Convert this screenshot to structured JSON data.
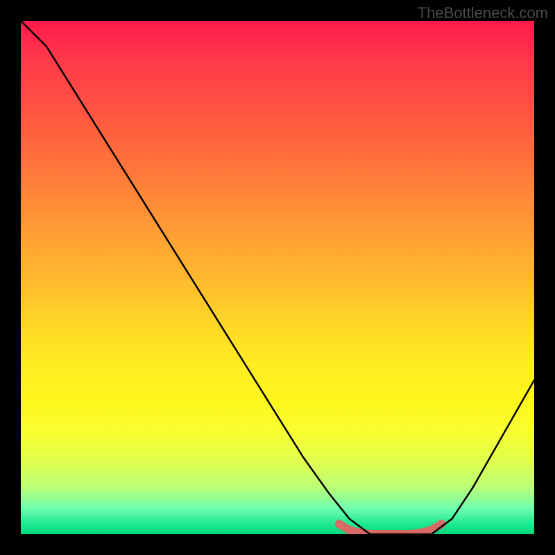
{
  "watermark": "TheBottleneck.com",
  "chart_data": {
    "type": "line",
    "title": "",
    "xlabel": "",
    "ylabel": "",
    "xlim": [
      0,
      100
    ],
    "ylim": [
      0,
      100
    ],
    "series": [
      {
        "name": "bottleneck-curve",
        "x": [
          0,
          5,
          10,
          15,
          20,
          25,
          30,
          35,
          40,
          45,
          50,
          55,
          60,
          64,
          68,
          72,
          76,
          80,
          84,
          88,
          92,
          96,
          100
        ],
        "values": [
          100,
          95,
          87,
          79,
          71,
          63,
          55,
          47,
          39,
          31,
          23,
          15,
          8,
          3,
          0,
          0,
          0,
          0,
          3,
          9,
          16,
          23,
          30
        ],
        "color": "#000000",
        "width": 2.5
      },
      {
        "name": "highlight-segment",
        "x": [
          62,
          64,
          66,
          68,
          70,
          72,
          74,
          76,
          78,
          80,
          82
        ],
        "values": [
          2,
          0.8,
          0.3,
          0,
          0,
          0,
          0,
          0,
          0.3,
          0.8,
          2
        ],
        "color": "#d96b66",
        "width": 12
      }
    ],
    "gradient_stops": [
      {
        "pos": 0,
        "color": "#ff1a4a"
      },
      {
        "pos": 50,
        "color": "#ffd428"
      },
      {
        "pos": 100,
        "color": "#00d87a"
      }
    ]
  }
}
